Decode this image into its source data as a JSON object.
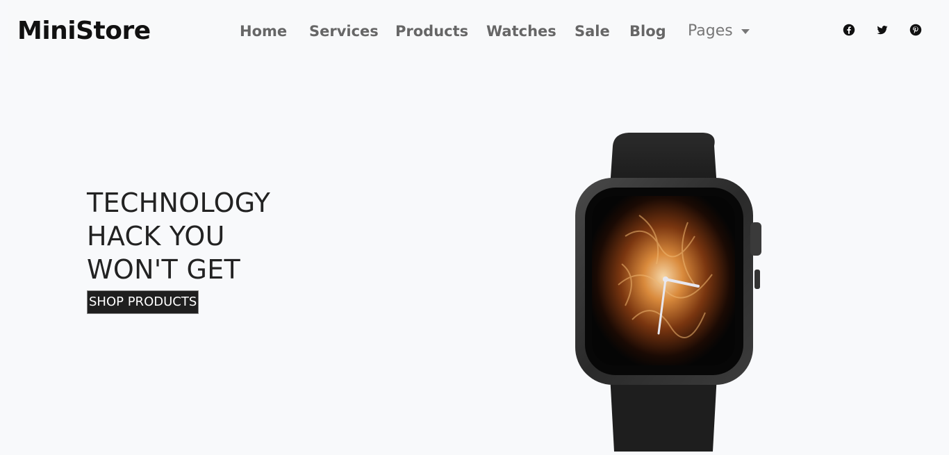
{
  "header": {
    "logo": "MiniStore",
    "nav": [
      {
        "label": "Home"
      },
      {
        "label": "Services"
      },
      {
        "label": "Products"
      },
      {
        "label": "Watches"
      },
      {
        "label": "Sale"
      },
      {
        "label": "Blog"
      }
    ],
    "pages_label": "Pages",
    "social": [
      "facebook-icon",
      "twitter-icon",
      "pinterest-icon"
    ]
  },
  "hero": {
    "title_lines": [
      "TECHNOLOGY",
      "HACK YOU",
      "WON'T GET"
    ],
    "button_label": "SHOP PRODUCTS",
    "image": "smartwatch-photo"
  },
  "colors": {
    "background": "#f8f9fb",
    "text_dark": "#222222",
    "nav_text": "#666666",
    "button_bg": "#1f1f1f",
    "button_text": "#ffffff"
  }
}
